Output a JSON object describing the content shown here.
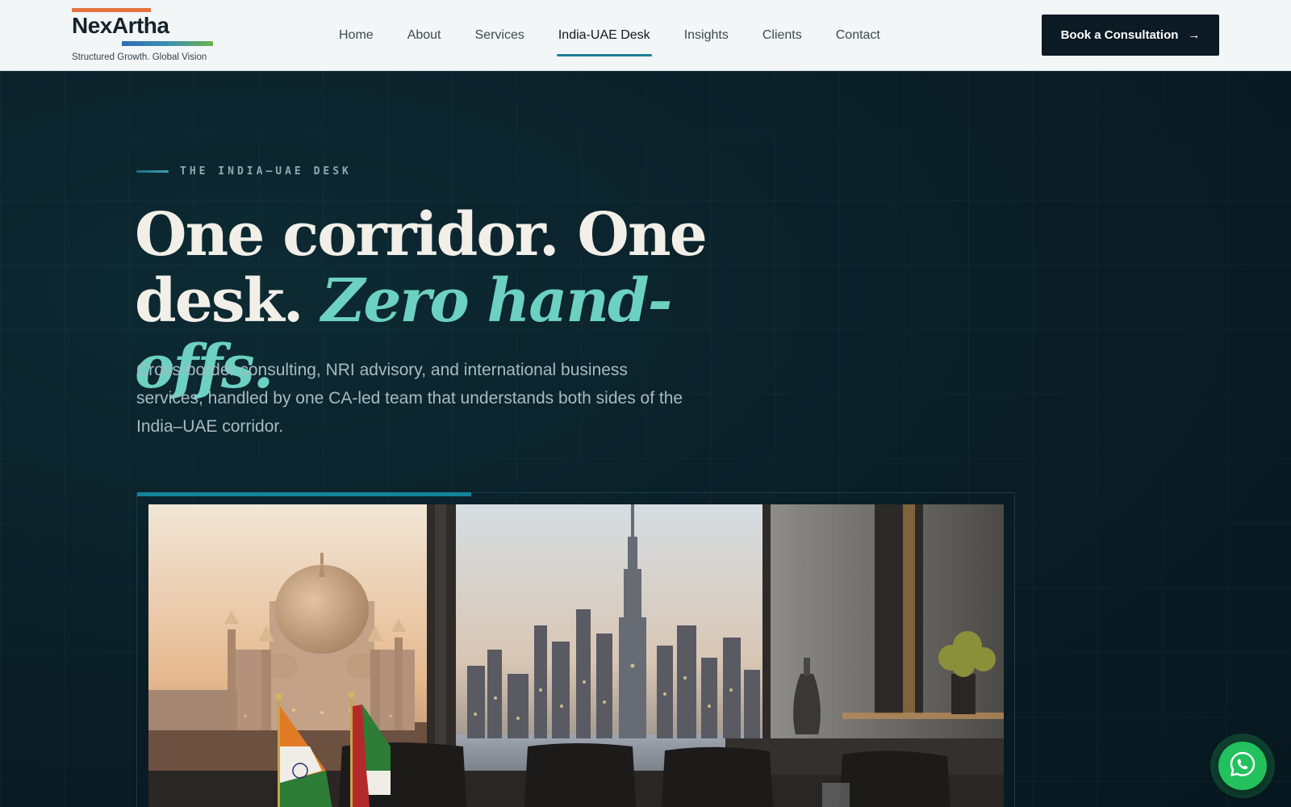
{
  "brand": {
    "name": "NexArtha",
    "tagline": "Structured Growth. Global Vision"
  },
  "nav": {
    "items": [
      {
        "label": "Home"
      },
      {
        "label": "About"
      },
      {
        "label": "Services"
      },
      {
        "label": "India-UAE Desk",
        "active": true
      },
      {
        "label": "Insights"
      },
      {
        "label": "Clients"
      },
      {
        "label": "Contact"
      }
    ]
  },
  "cta": {
    "label": "Book a Consultation",
    "arrow": "→"
  },
  "hero": {
    "eyebrow": "THE INDIA–UAE DESK",
    "headline_line1": "One corridor. One",
    "headline_line2_plain": "desk.",
    "headline_accent": "Zero hand-offs.",
    "lede": "Cross-border consulting, NRI advisory, and international business services, handled by one CA-led team that understands both sides of the India–UAE corridor."
  },
  "image": {
    "icon": "photo-taj-mahal-and-dubai-skyline"
  },
  "whatsapp": {
    "icon": "whatsapp-icon"
  },
  "colors": {
    "accent": "#6cd1c2",
    "teal": "#13849a",
    "dark": "#0b1a23",
    "logo_orange": "#e2733f",
    "whatsapp_green": "#23c15d"
  }
}
